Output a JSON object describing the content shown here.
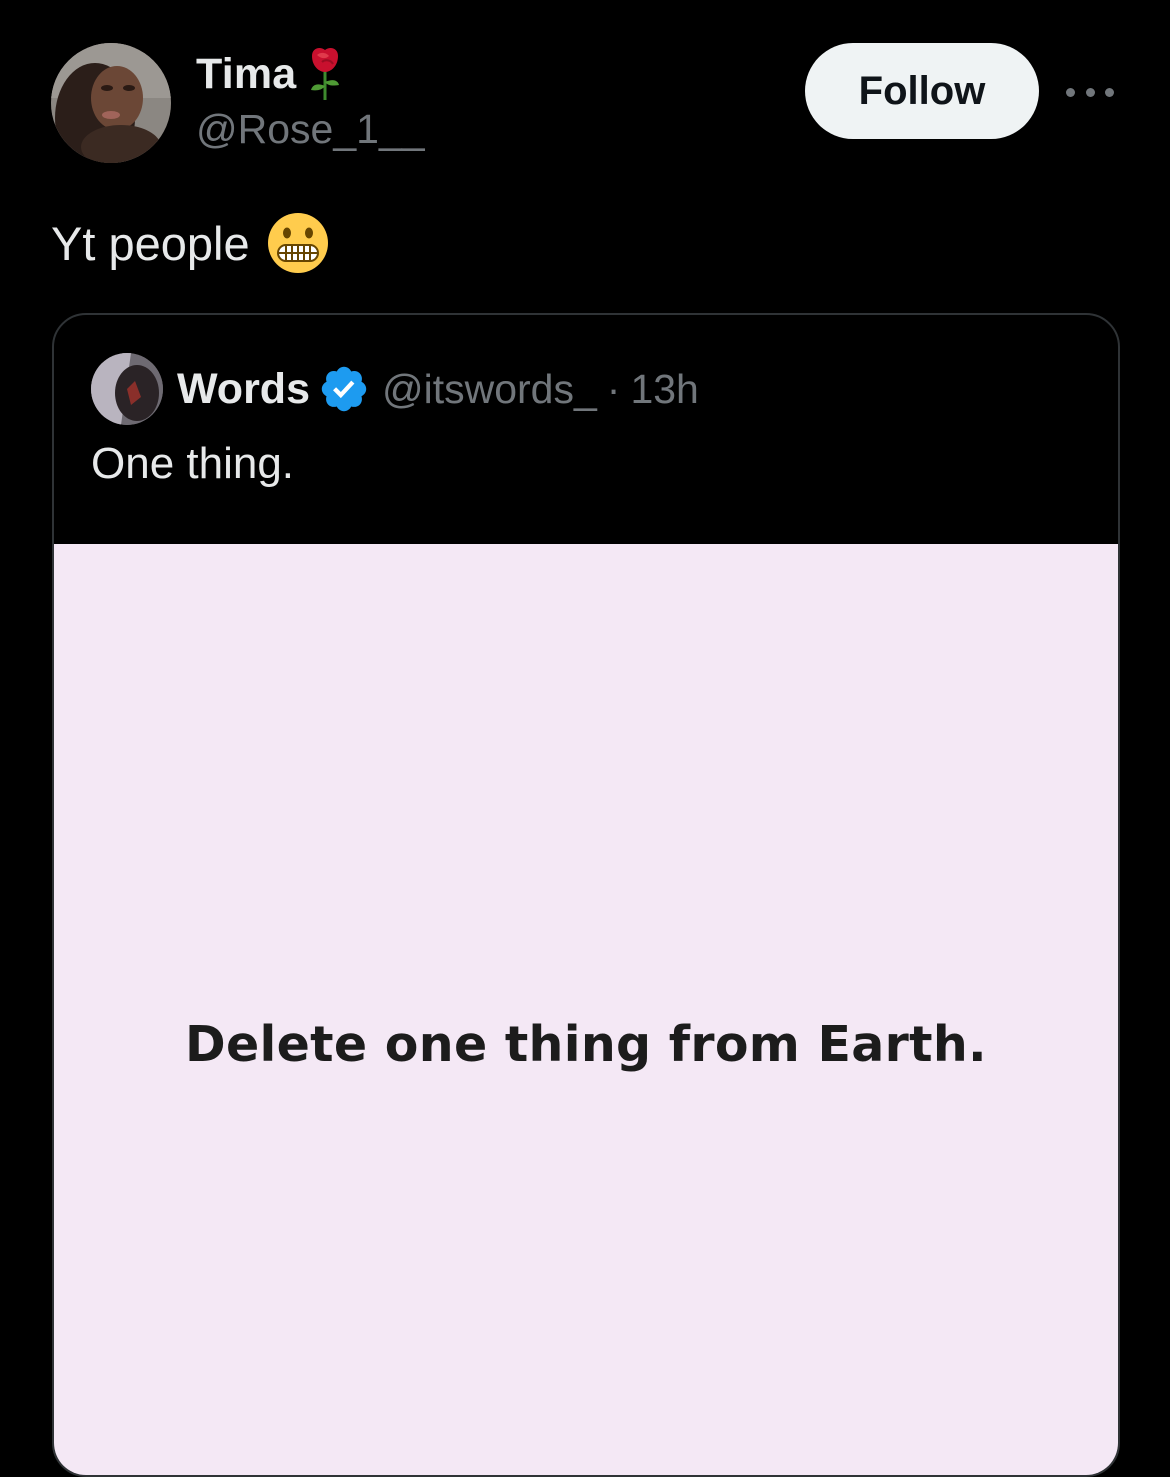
{
  "tweet": {
    "author": {
      "display_name": "Tima",
      "name_emoji": "rose-icon",
      "handle": "@Rose_1__"
    },
    "follow_label": "Follow",
    "more_icon": "more-icon",
    "text": "Yt people",
    "text_emoji": "grimacing-face-icon"
  },
  "quote": {
    "author": {
      "display_name": "Words",
      "verified": true,
      "handle": "@itswords_",
      "separator": "·",
      "time": "13h"
    },
    "text": "One thing.",
    "media": {
      "caption": "Delete one thing from Earth.",
      "background": "#f4e8f5"
    }
  },
  "colors": {
    "background": "#000000",
    "primary_text": "#e7e9ea",
    "secondary_text": "#71767b",
    "border": "#2f3336",
    "follow_button_bg": "#eff3f4",
    "verified_blue": "#1d9bf0"
  }
}
